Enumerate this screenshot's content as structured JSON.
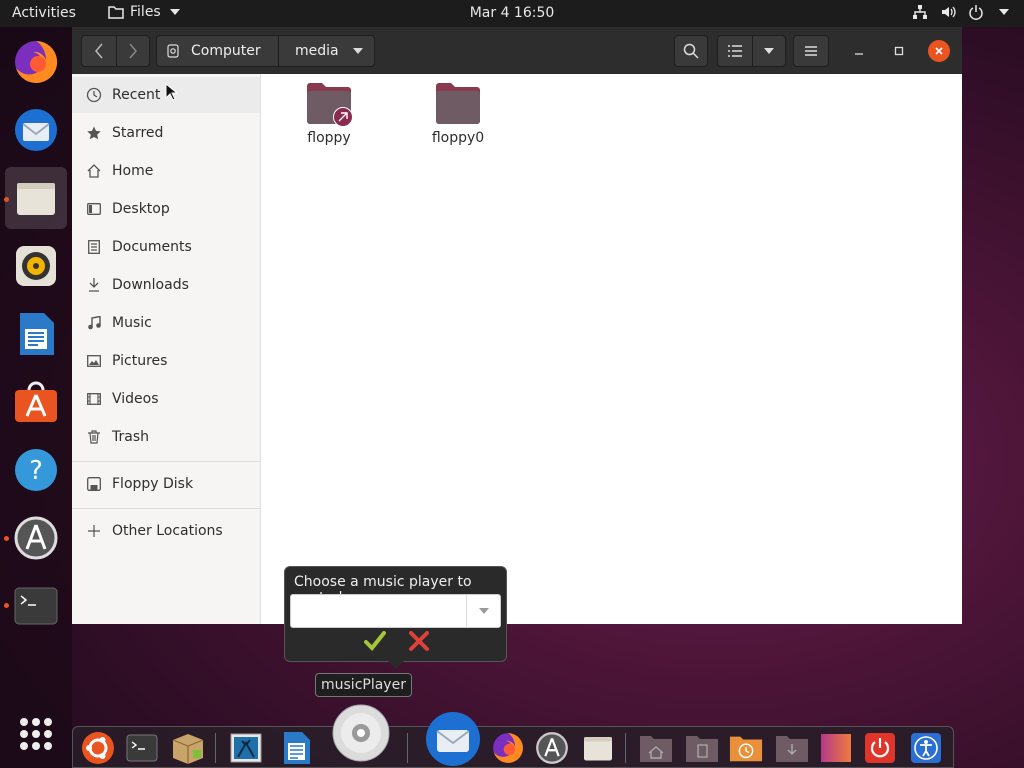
{
  "topbar": {
    "activities": "Activities",
    "app_menu": "Files",
    "clock": "Mar 4  16:50"
  },
  "window": {
    "breadcrumb": [
      "Computer",
      "media"
    ]
  },
  "sidebar": {
    "items": [
      {
        "label": "Recent",
        "icon": "clock-icon"
      },
      {
        "label": "Starred",
        "icon": "star-icon"
      },
      {
        "label": "Home",
        "icon": "home-icon"
      },
      {
        "label": "Desktop",
        "icon": "desktop-icon"
      },
      {
        "label": "Documents",
        "icon": "document-icon"
      },
      {
        "label": "Downloads",
        "icon": "download-icon"
      },
      {
        "label": "Music",
        "icon": "music-icon"
      },
      {
        "label": "Pictures",
        "icon": "picture-icon"
      },
      {
        "label": "Videos",
        "icon": "video-icon"
      },
      {
        "label": "Trash",
        "icon": "trash-icon"
      }
    ],
    "devices": [
      {
        "label": "Floppy Disk",
        "icon": "floppy-icon"
      }
    ],
    "other": {
      "label": "Other Locations",
      "icon": "plus-icon"
    }
  },
  "content": {
    "folders": [
      {
        "name": "floppy",
        "symlink": true
      },
      {
        "name": "floppy0",
        "symlink": false
      }
    ]
  },
  "popup": {
    "title": "Choose a music player to control",
    "value": "",
    "tooltip": "musicPlayer"
  },
  "colors": {
    "accent": "#e95420",
    "folder": "#6e5b63",
    "folder_tab": "#8a3a4e"
  }
}
